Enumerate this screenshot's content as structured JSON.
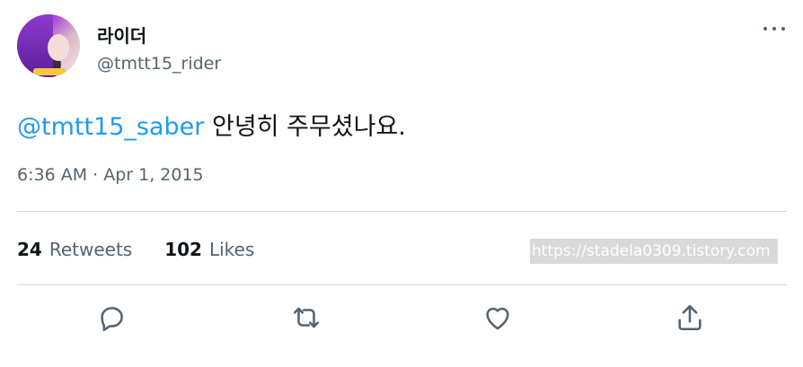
{
  "tweet": {
    "display_name": "라이더",
    "handle": "@tmtt15_rider",
    "mention": "@tmtt15_saber",
    "text": " 안녕히 주무셨나요.",
    "timestamp": "6:36 AM · Apr 1, 2015"
  },
  "stats": {
    "retweets_count": "24",
    "retweets_label": "Retweets",
    "likes_count": "102",
    "likes_label": "Likes"
  },
  "watermark": "https://stadela0309.tistory.com",
  "icons": {
    "reply": "reply-icon",
    "retweet": "retweet-icon",
    "like": "heart-icon",
    "share": "share-icon",
    "more": "more-icon"
  },
  "colors": {
    "mention": "#1d9bf0",
    "secondary_text": "#536471",
    "divider": "#cfd9de"
  }
}
